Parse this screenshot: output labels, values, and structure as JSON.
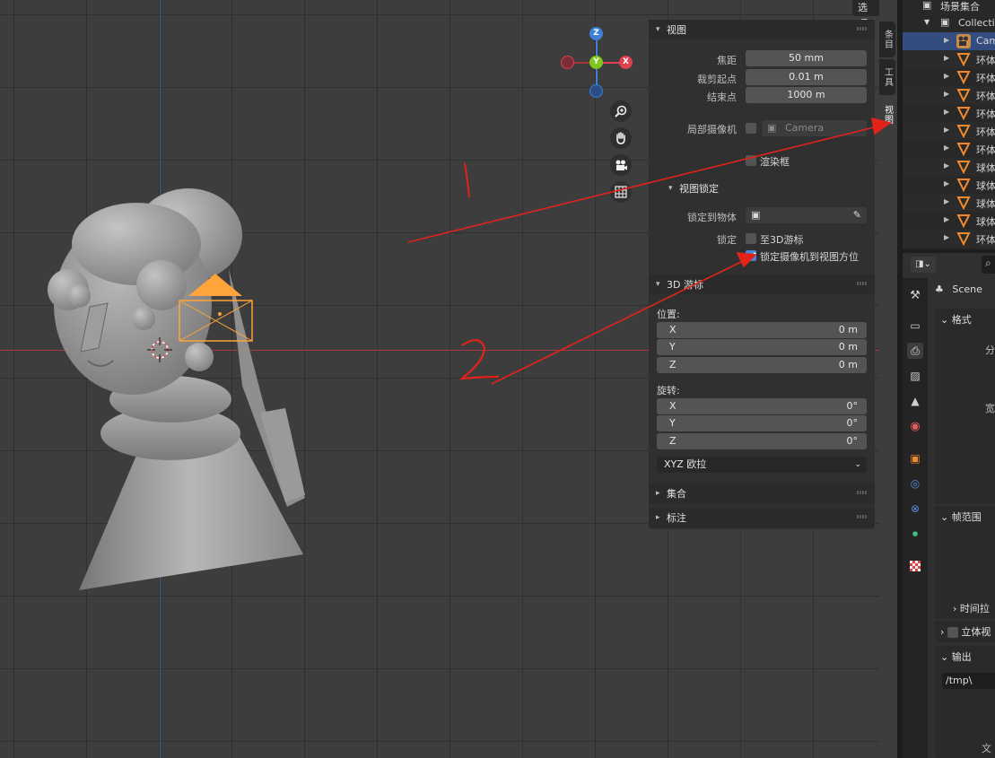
{
  "viewport": {
    "options_label": "选项",
    "gizmo": {
      "x": "X",
      "y": "Y",
      "z": "Z"
    },
    "annotations": {
      "one": "1",
      "two": "2"
    }
  },
  "sidebar_tabs": [
    "条目",
    "工具",
    "视图"
  ],
  "npanel": {
    "view_section": {
      "title": "视图",
      "focal_label": "焦距",
      "focal_value": "50 mm",
      "clip_start_label": "裁剪起点",
      "clip_start_value": "0.01 m",
      "clip_end_label": "结束点",
      "clip_end_value": "1000 m",
      "local_camera_label": "局部摄像机",
      "local_camera_value": "Camera",
      "render_border_label": "渲染框"
    },
    "view_lock": {
      "title": "视图锁定",
      "lock_to_object_label": "锁定到物体",
      "lock_label": "锁定",
      "to_3d_cursor_label": "至3D游标",
      "lock_camera_to_view_label": "锁定摄像机到视图方位",
      "lock_camera_to_view_checked": true
    },
    "cursor_section": {
      "title": "3D 游标",
      "location_label": "位置:",
      "location": [
        {
          "axis": "X",
          "value": "0 m"
        },
        {
          "axis": "Y",
          "value": "0 m"
        },
        {
          "axis": "Z",
          "value": "0 m"
        }
      ],
      "rotation_label": "旋转:",
      "rotation": [
        {
          "axis": "X",
          "value": "0°"
        },
        {
          "axis": "Y",
          "value": "0°"
        },
        {
          "axis": "Z",
          "value": "0°"
        }
      ],
      "rotation_mode": "XYZ 欧拉"
    },
    "collections_title": "集合",
    "annotations_title": "标注"
  },
  "outliner": {
    "scene_collection": "场景集合",
    "collection": "Collecti",
    "items": [
      {
        "name": "Cam",
        "type": "camera",
        "selected": true
      },
      {
        "name": "环体"
      },
      {
        "name": "环体"
      },
      {
        "name": "环体"
      },
      {
        "name": "环体"
      },
      {
        "name": "环体"
      },
      {
        "name": "环体"
      },
      {
        "name": "球体"
      },
      {
        "name": "球体"
      },
      {
        "name": "球体"
      },
      {
        "name": "球体"
      },
      {
        "name": "环体"
      }
    ]
  },
  "properties": {
    "scene_name": "Scene",
    "format_title": "格式",
    "resolution_fragment": "分",
    "width_fragment": "宽",
    "frame_range_title": "帧范围",
    "time_stretch_fragment": "时间拉",
    "stereo_title": "立体视",
    "output_title": "输出",
    "output_path": "/tmp\\",
    "file_fragment": "文"
  },
  "colors": {
    "accent_blue": "#4a86d6",
    "selected_row": "#334d80",
    "camera_orange": "#ffa43a",
    "annotation_red": "#e3231b",
    "axis_x": "#e0414f",
    "axis_y": "#7ec81d",
    "axis_z": "#3d80d6"
  }
}
